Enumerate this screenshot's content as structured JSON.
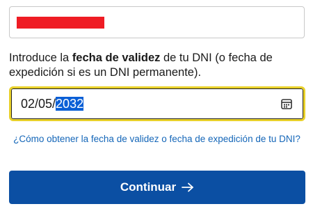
{
  "top_field": {
    "redacted_color": "#ef1c24"
  },
  "instruction": {
    "prefix": "Introduce la ",
    "bold": "fecha de validez",
    "suffix": " de tu DNI (o fecha de expedición si es un DNI permanente)."
  },
  "date_input": {
    "day_month": "02/05/",
    "year_selected": "2032",
    "icon": "calendar-icon"
  },
  "help_link": {
    "label": "¿Cómo obtener la fecha de validez o fecha de expedición de tu DNI?"
  },
  "continue_button": {
    "label": "Continuar",
    "icon": "arrow-right-icon",
    "color": "#0b4fa3"
  },
  "colors": {
    "focus_ring": "#e9d12a",
    "link": "#1466b8",
    "selection": "#0a5fd6"
  }
}
